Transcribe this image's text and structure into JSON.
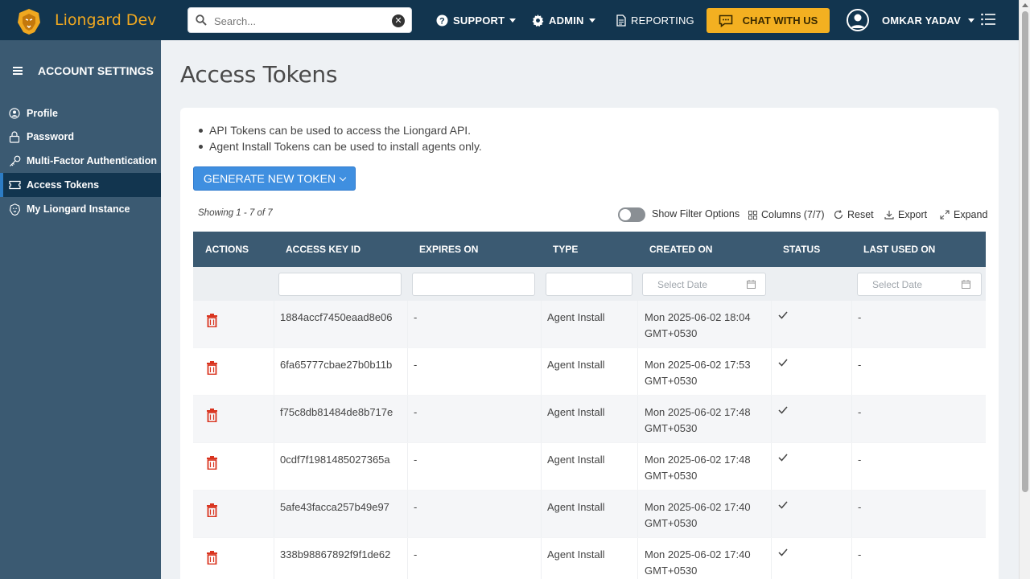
{
  "app": {
    "brand": "Liongard Dev"
  },
  "search": {
    "placeholder": "Search..."
  },
  "nav": {
    "support": "SUPPORT",
    "admin": "ADMIN",
    "reporting": "REPORTING",
    "chat": "CHAT WITH US",
    "user": "OMKAR YADAV"
  },
  "sidebar": {
    "title": "ACCOUNT SETTINGS",
    "items": [
      {
        "label": "Profile",
        "icon": "user-circle-icon"
      },
      {
        "label": "Password",
        "icon": "lock-icon"
      },
      {
        "label": "Multi-Factor Authentication",
        "icon": "key-icon"
      },
      {
        "label": "Access Tokens",
        "icon": "ticket-icon",
        "active": true
      },
      {
        "label": "My Liongard Instance",
        "icon": "lion-icon"
      }
    ]
  },
  "page": {
    "title": "Access Tokens",
    "bullets": [
      "API Tokens can be used to access the Liongard API.",
      "Agent Install Tokens can be used to install agents only."
    ],
    "generate_button": "GENERATE NEW TOKEN",
    "showing": "Showing 1 - 7 of 7",
    "toolbar": {
      "filter_toggle": "Show Filter Options",
      "columns": "Columns (7/7)",
      "reset": "Reset",
      "export": "Export",
      "expand": "Expand"
    }
  },
  "table": {
    "columns": [
      "ACTIONS",
      "ACCESS KEY ID",
      "EXPIRES ON",
      "TYPE",
      "CREATED ON",
      "STATUS",
      "LAST USED ON"
    ],
    "date_placeholder": "Select Date",
    "rows": [
      {
        "key": "1884accf7450eaad8e06",
        "expires": "-",
        "type": "Agent Install",
        "created_1": "Mon 2025-06-02 18:04",
        "created_2": "GMT+0530",
        "status": "active",
        "last_used": "-"
      },
      {
        "key": "6fa65777cbae27b0b11b",
        "expires": "-",
        "type": "Agent Install",
        "created_1": "Mon 2025-06-02 17:53",
        "created_2": "GMT+0530",
        "status": "active",
        "last_used": "-"
      },
      {
        "key": "f75c8db81484de8b717e",
        "expires": "-",
        "type": "Agent Install",
        "created_1": "Mon 2025-06-02 17:48",
        "created_2": "GMT+0530",
        "status": "active",
        "last_used": "-"
      },
      {
        "key": "0cdf7f1981485027365a",
        "expires": "-",
        "type": "Agent Install",
        "created_1": "Mon 2025-06-02 17:48",
        "created_2": "GMT+0530",
        "status": "active",
        "last_used": "-"
      },
      {
        "key": "5afe43facca257b49e97",
        "expires": "-",
        "type": "Agent Install",
        "created_1": "Mon 2025-06-02 17:40",
        "created_2": "GMT+0530",
        "status": "active",
        "last_used": "-"
      },
      {
        "key": "338b98867892f9f1de62",
        "expires": "-",
        "type": "Agent Install",
        "created_1": "Mon 2025-06-02 17:40",
        "created_2": "GMT+0530",
        "status": "active",
        "last_used": "-"
      }
    ]
  },
  "colors": {
    "topbar": "#12354f",
    "sidebar": "#3b5a72",
    "accent_orange": "#f3b021",
    "primary_button": "#3f8fe0",
    "delete_red": "#d9341f"
  }
}
